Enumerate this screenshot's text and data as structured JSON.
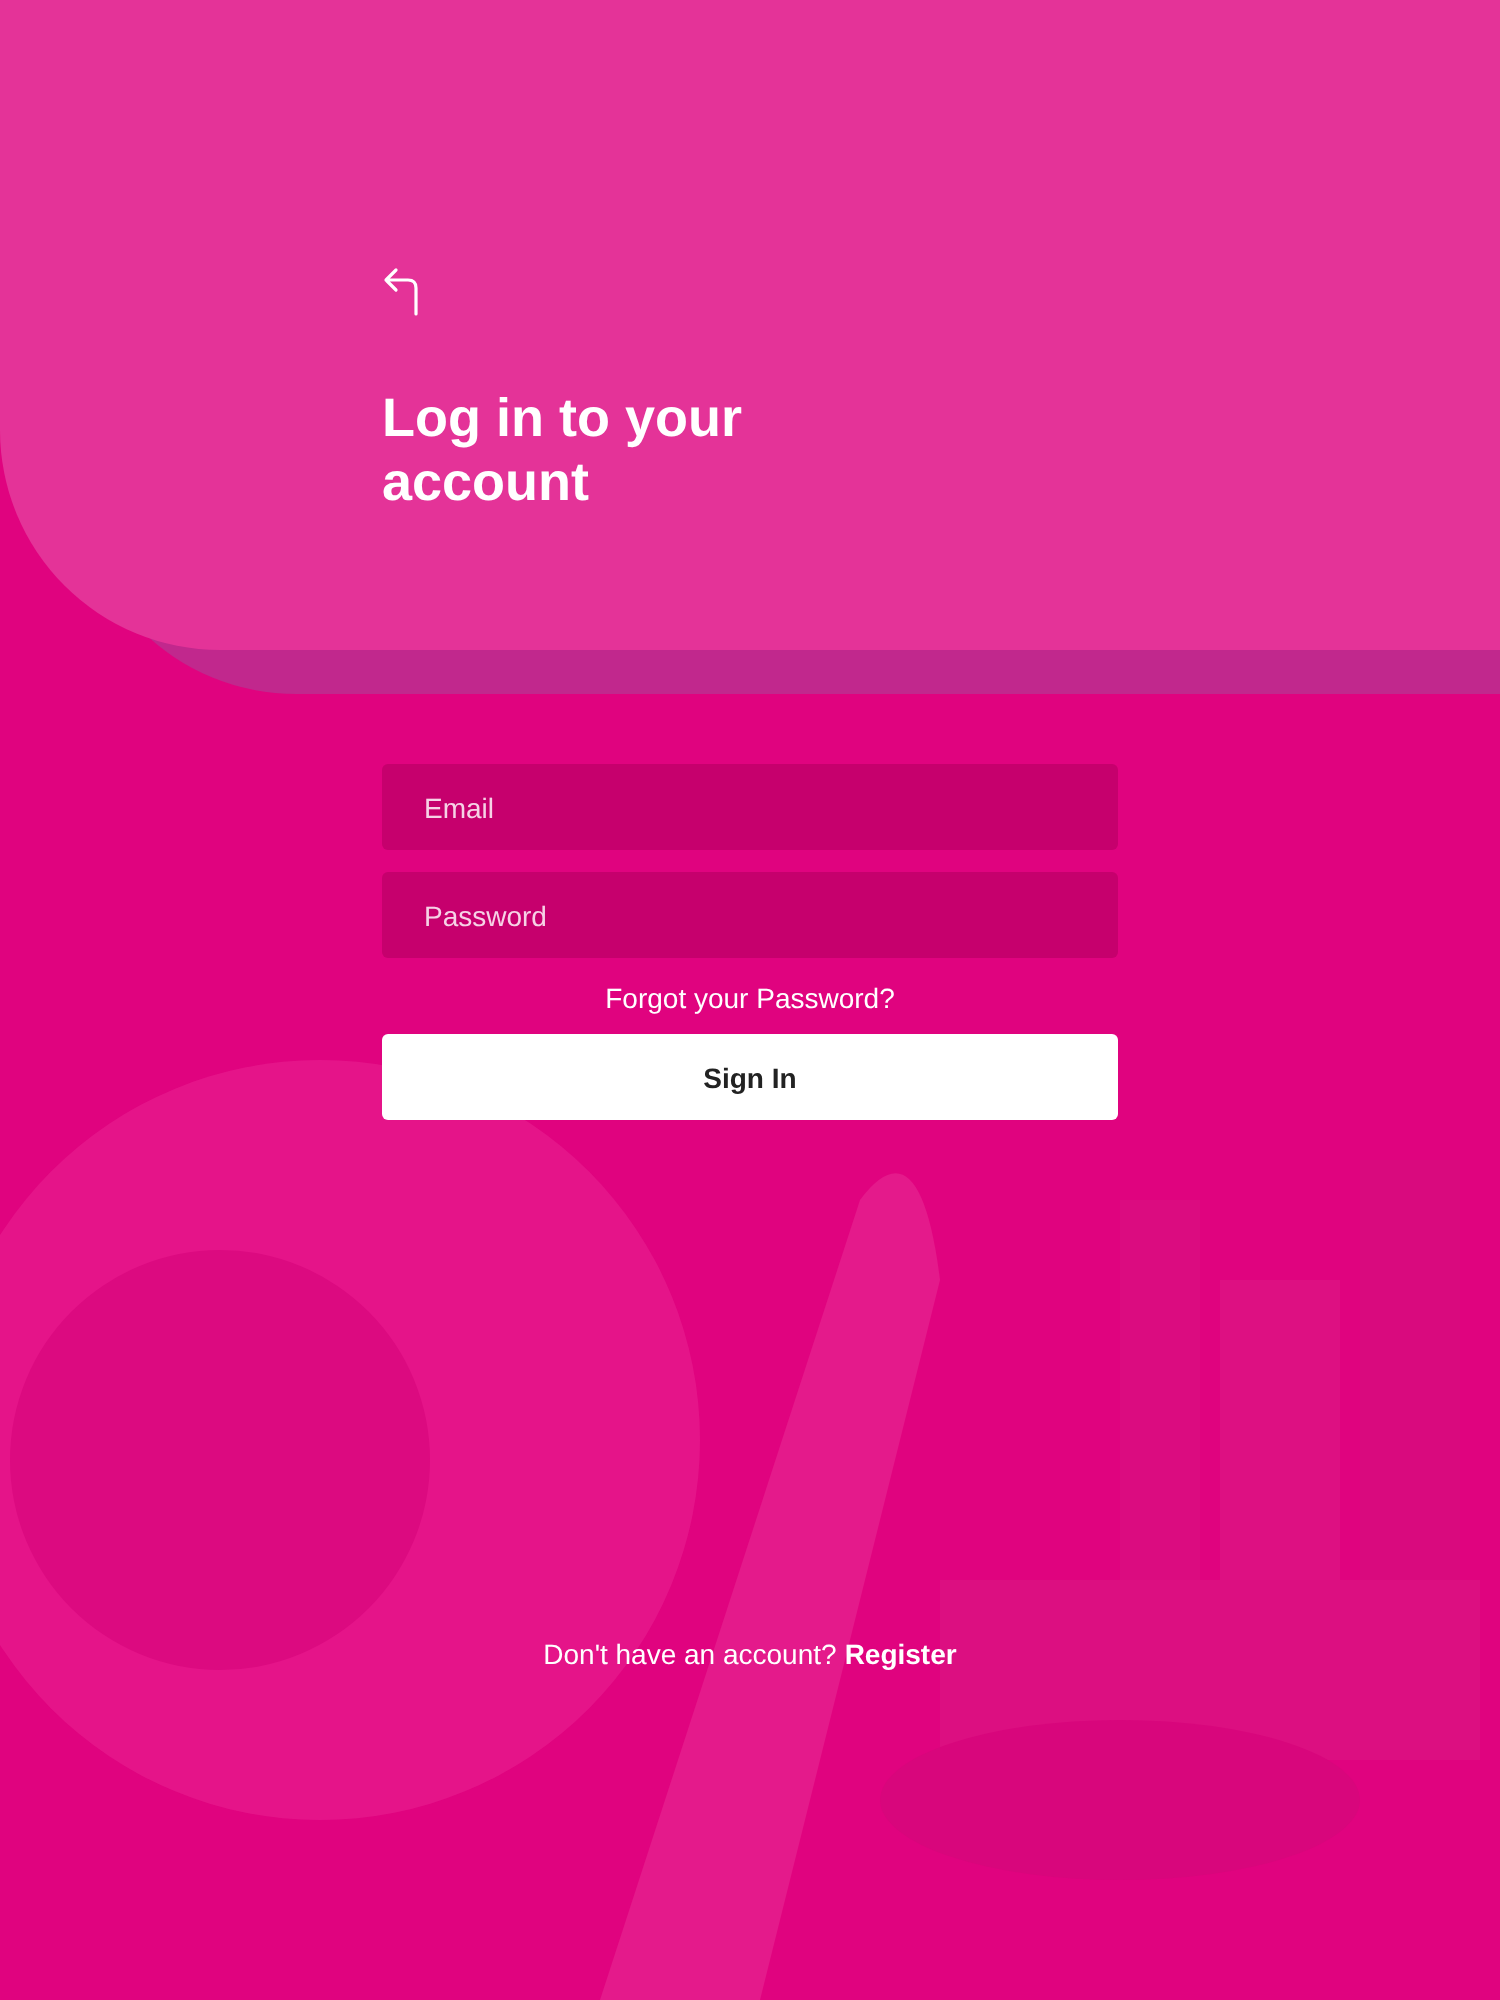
{
  "header": {
    "title": "Log in to your account"
  },
  "form": {
    "email": {
      "placeholder": "Email"
    },
    "password": {
      "placeholder": "Password"
    },
    "forgot_link": "Forgot your Password?",
    "submit": "Sign In"
  },
  "footer": {
    "prompt": "Don't have an account?",
    "link": "Register"
  }
}
